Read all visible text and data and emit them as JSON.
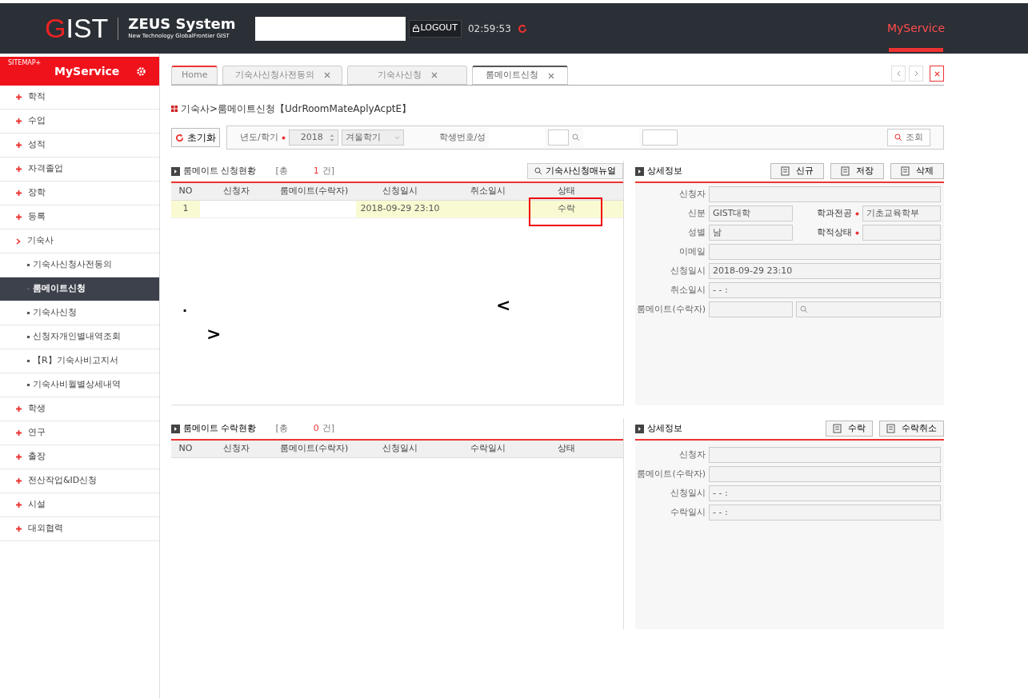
{
  "header": {
    "logo": "GIST",
    "system_title": "ZEUS System",
    "system_subtitle": "New Technology GlobalFrontier GIST",
    "logout": "LOGOUT",
    "timer": "02:59:53",
    "nav": [
      {
        "label": "MyService",
        "selected": true
      }
    ]
  },
  "sidebar": {
    "sitemap": "SITEMAP+",
    "title": "MyService",
    "items": [
      {
        "label": "학적",
        "expanded": false
      },
      {
        "label": "수업",
        "expanded": false
      },
      {
        "label": "성적",
        "expanded": false
      },
      {
        "label": "자격졸업",
        "expanded": false
      },
      {
        "label": "장학",
        "expanded": false
      },
      {
        "label": "등록",
        "expanded": false
      },
      {
        "label": "기숙사",
        "expanded": true,
        "children": [
          {
            "label": "기숙사신청사전동의",
            "selected": false
          },
          {
            "label": "룸메이트신청",
            "selected": true
          },
          {
            "label": "기숙사신청",
            "selected": false
          },
          {
            "label": "신청자개인별내역조회",
            "selected": false
          },
          {
            "label": "【R】기숙사비고지서",
            "selected": false
          },
          {
            "label": "기숙사비월별상세내역",
            "selected": false
          }
        ]
      },
      {
        "label": "학생",
        "expanded": false
      },
      {
        "label": "연구",
        "expanded": false
      },
      {
        "label": "출장",
        "expanded": false
      },
      {
        "label": "전산작업&ID신청",
        "expanded": false
      },
      {
        "label": "시설",
        "expanded": false
      },
      {
        "label": "대외협력",
        "expanded": false
      }
    ]
  },
  "tabs": [
    {
      "label": "Home",
      "selected": false,
      "closable": false
    },
    {
      "label": "기숙사신청사전동의",
      "selected": false,
      "closable": true
    },
    {
      "label": "기숙사신청",
      "selected": false,
      "closable": true
    },
    {
      "label": "룸메이트신청",
      "selected": true,
      "closable": true
    }
  ],
  "page_title": "기숙사>룸메이트신청【UdrRoomMateAplyAcptE】",
  "search": {
    "reset": "초기화",
    "year_label": "년도/학기",
    "year": "2018",
    "term": "겨울학기",
    "student_label": "학생번호/성",
    "query": "조회"
  },
  "application": {
    "title": "룸메이트 신청현황",
    "count_prefix": "[총",
    "count": "1",
    "count_suffix": "건]",
    "manual": "기숙사신청매뉴얼",
    "columns": [
      "NO",
      "신청자",
      "룸메이트(수락자)",
      "신청일시",
      "취소일시",
      "상태"
    ],
    "rows": [
      {
        "cells": [
          "1",
          null,
          null,
          "2018-09-29 23:10",
          null,
          "수락"
        ],
        "selected": true
      }
    ]
  },
  "application_detail": {
    "title": "상세정보",
    "buttons": [
      "신규",
      "저장",
      "삭제"
    ],
    "fields": [
      {
        "label": "신청자",
        "kind": "full"
      },
      {
        "label": "신분",
        "value": "GIST대학",
        "kind": "pair",
        "label2": "학과전공",
        "value2": "기초교육학부"
      },
      {
        "label": "성별",
        "value": "남",
        "kind": "pair",
        "label2": "학적상태"
      },
      {
        "label": "이메일",
        "kind": "full"
      },
      {
        "label": "신청일시",
        "value": "2018-09-29 23:10",
        "kind": "full"
      },
      {
        "label": "취소일시",
        "value": "- -   :",
        "kind": "full"
      },
      {
        "label": "룸메이트(수락자)",
        "kind": "search"
      }
    ]
  },
  "annotations": [
    {
      "text": ".",
      "kind": "dot"
    },
    {
      "text": "<",
      "kind": "left"
    },
    {
      "text": ">",
      "kind": "right"
    }
  ],
  "acceptance": {
    "title": "룸메이트 수락현황",
    "count_prefix": "[총",
    "count": "0",
    "count_suffix": "건]",
    "columns": [
      "NO",
      "신청자",
      "룸메이트(수락자)",
      "신청일시",
      "수락일시",
      "상태"
    ]
  },
  "acceptance_detail": {
    "title": "상세정보",
    "buttons": [
      "수락",
      "수락취소"
    ],
    "fields": [
      {
        "label": "신청자",
        "kind": "full"
      },
      {
        "label": "룸메이트(수락자)",
        "kind": "full"
      },
      {
        "label": "신청일시",
        "value": "- -   :",
        "kind": "full"
      },
      {
        "label": "수락일시",
        "value": "- -   :",
        "kind": "full"
      }
    ]
  }
}
